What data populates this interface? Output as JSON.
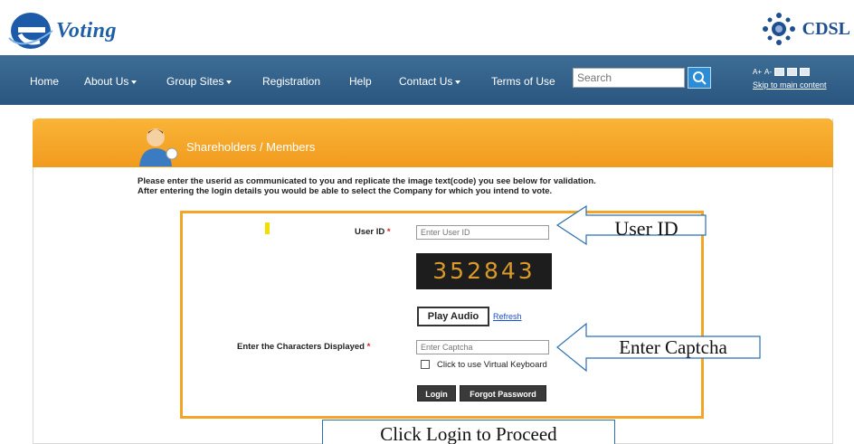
{
  "header": {
    "logo_text": "Voting",
    "cdsl_text": "CDSL"
  },
  "nav": {
    "items": [
      {
        "label": "Home"
      },
      {
        "label": "About Us"
      },
      {
        "label": "Group Sites"
      },
      {
        "label": "Registration"
      },
      {
        "label": "Help"
      },
      {
        "label": "Contact Us"
      },
      {
        "label": "Terms of Use"
      }
    ],
    "search_placeholder": "Search",
    "font_small": "A+",
    "font_smaller": "A-",
    "skip_link": "Skip to main content"
  },
  "panel": {
    "title": "Shareholders / Members",
    "instruction_line1": "Please enter the userid as communicated to you and replicate the image text(code) you see below for validation.",
    "instruction_line2": "After entering the login details you would be able to select the Company for which you intend to vote."
  },
  "form": {
    "userid_label": "User ID",
    "userid_placeholder": "Enter User ID",
    "required_mark": "*",
    "captcha_code": "352843",
    "play_audio": "Play Audio",
    "refresh": "Refresh",
    "captcha_label": "Enter the Characters Displayed",
    "captcha_placeholder": "Enter Captcha",
    "virtual_keyboard_label": "Click to use Virtual Keyboard",
    "login_button": "Login",
    "forgot_password_button": "Forgot Password"
  },
  "annotations": {
    "userid_callout": "User ID",
    "captcha_callout": "Enter Captcha",
    "login_callout": "Click Login to Proceed"
  },
  "colors": {
    "nav_bg": "#2f5e88",
    "panel_accent": "#f4a526",
    "link": "#1a4fd6"
  }
}
